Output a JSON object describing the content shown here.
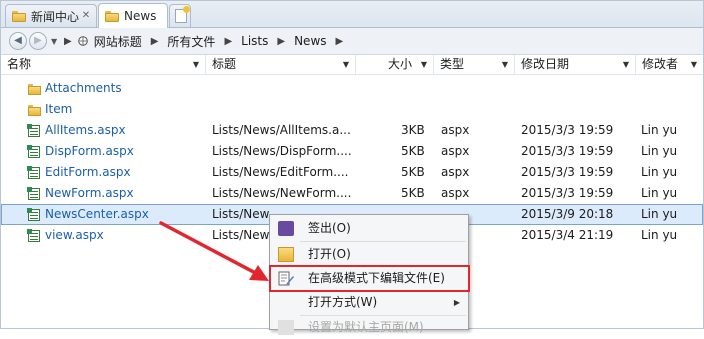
{
  "tabs": [
    {
      "label": "新闻中心"
    },
    {
      "label": "News"
    }
  ],
  "breadcrumbs": [
    "网站标题",
    "所有文件",
    "Lists",
    "News"
  ],
  "columns": {
    "name": "名称",
    "title": "标题",
    "size": "大小",
    "type": "类型",
    "modified": "修改日期",
    "modified_by": "修改者"
  },
  "rows": [
    {
      "name": "Attachments",
      "kind": "folder",
      "title": "",
      "size": "",
      "type": "",
      "modified": "",
      "modified_by": ""
    },
    {
      "name": "Item",
      "kind": "folder",
      "title": "",
      "size": "",
      "type": "",
      "modified": "",
      "modified_by": ""
    },
    {
      "name": "AllItems.aspx",
      "kind": "file",
      "title": "Lists/News/AllItems.a...",
      "size": "3KB",
      "type": "aspx",
      "modified": "2015/3/3 19:59",
      "modified_by": "Lin yu"
    },
    {
      "name": "DispForm.aspx",
      "kind": "file",
      "title": "Lists/News/DispForm....",
      "size": "5KB",
      "type": "aspx",
      "modified": "2015/3/3 19:59",
      "modified_by": "Lin yu"
    },
    {
      "name": "EditForm.aspx",
      "kind": "file",
      "title": "Lists/News/EditForm....",
      "size": "5KB",
      "type": "aspx",
      "modified": "2015/3/3 19:59",
      "modified_by": "Lin yu"
    },
    {
      "name": "NewForm.aspx",
      "kind": "file",
      "title": "Lists/News/NewForm....",
      "size": "5KB",
      "type": "aspx",
      "modified": "2015/3/3 19:59",
      "modified_by": "Lin yu"
    },
    {
      "name": "NewsCenter.aspx",
      "kind": "file",
      "title": "Lists/News",
      "size": "",
      "type": "",
      "modified": "2015/3/9 20:18",
      "modified_by": "Lin yu"
    },
    {
      "name": "view.aspx",
      "kind": "file",
      "title": "Lists/News",
      "size": "",
      "type": "",
      "modified": "2015/3/4 21:19",
      "modified_by": "Lin yu"
    }
  ],
  "context_menu": {
    "items": [
      {
        "label": "签出(O)",
        "icon": "checkout-icon"
      },
      {
        "label": "打开(O)",
        "icon": "open-folder-icon"
      },
      {
        "label": "在高级模式下编辑文件(E)",
        "icon": "edit-file-icon",
        "highlighted": true
      },
      {
        "label": "打开方式(W)",
        "icon": "",
        "submenu": true
      },
      {
        "label": "设置为默认主页面(M)",
        "icon": "",
        "disabled": true
      }
    ]
  },
  "colors": {
    "highlight_border": "#e2262e",
    "selection_bg": "#dcebfc",
    "link_text": "#1a5fa8"
  }
}
